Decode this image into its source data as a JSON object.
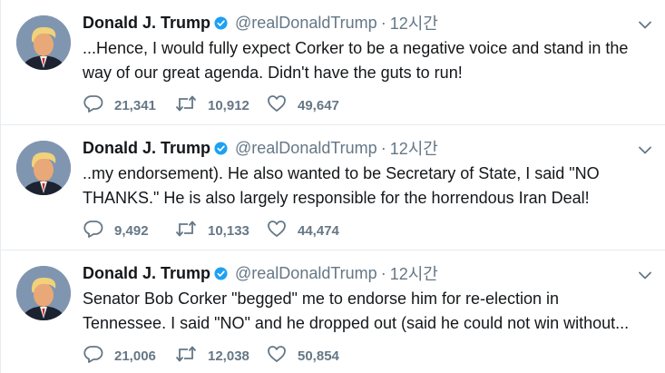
{
  "tweets": [
    {
      "author": "Donald J. Trump",
      "handle": "@realDonaldTrump",
      "separator": "·",
      "time": "12시간",
      "lines": [
        "...Hence, I would fully expect Corker to be a negative voice and stand in the",
        "way of our great agenda. Didn't have the guts to run!"
      ],
      "replies": "21,341",
      "retweets": "10,912",
      "likes": "49,647"
    },
    {
      "author": "Donald J. Trump",
      "handle": "@realDonaldTrump",
      "separator": "·",
      "time": "12시간",
      "lines": [
        "..my endorsement). He also wanted to be Secretary of State, I said \"NO",
        "THANKS.\" He is also largely responsible for the horrendous Iran Deal!"
      ],
      "replies": "9,492",
      "retweets": "10,133",
      "likes": "44,474"
    },
    {
      "author": "Donald J. Trump",
      "handle": "@realDonaldTrump",
      "separator": "·",
      "time": "12시간",
      "lines": [
        "Senator Bob Corker \"begged\" me to endorse him for re-election in",
        "Tennessee. I said \"NO\" and he dropped out (said he could not win without..."
      ],
      "replies": "21,006",
      "retweets": "12,038",
      "likes": "50,854"
    }
  ],
  "icons": {
    "verified": "verified-badge-icon",
    "caret": "chevron-down-icon",
    "reply": "reply-icon",
    "retweet": "retweet-icon",
    "like": "heart-icon"
  },
  "colors": {
    "verified": "#1da1f2",
    "secondary_text": "#657786",
    "icon": "#657786",
    "divider": "#e6ecf0"
  }
}
